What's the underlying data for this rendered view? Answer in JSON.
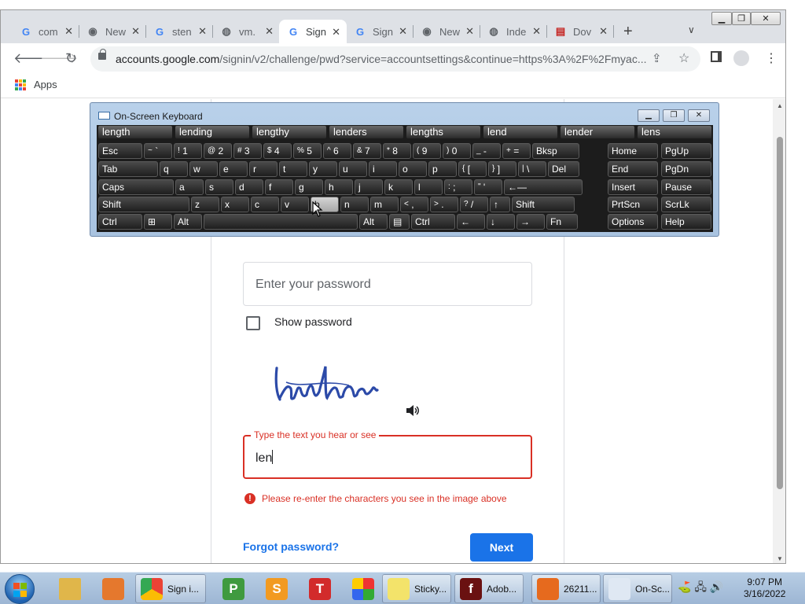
{
  "tabs": [
    {
      "title": "com",
      "favicon": "google-icon",
      "active": false
    },
    {
      "title": "New",
      "favicon": "chrome-icon",
      "active": false
    },
    {
      "title": "sten",
      "favicon": "google-icon",
      "active": false
    },
    {
      "title": "vm.",
      "favicon": "globe-icon",
      "active": false
    },
    {
      "title": "Sign",
      "favicon": "google-icon",
      "active": true
    },
    {
      "title": "Sign",
      "favicon": "google-icon",
      "active": false
    },
    {
      "title": "New",
      "favicon": "chrome-icon",
      "active": false
    },
    {
      "title": "Inde",
      "favicon": "globe-icon",
      "active": false
    },
    {
      "title": "Dov",
      "favicon": "doc-icon",
      "active": false
    }
  ],
  "omnibox": {
    "host": "accounts.google.com",
    "path": "/signin/v2/challenge/pwd?service=accountsettings&continue=https%3A%2F%2Fmyac..."
  },
  "bookmarks": {
    "apps_label": "Apps"
  },
  "signin": {
    "password_placeholder": "Enter your password",
    "show_password_label": "Show password",
    "captcha_label": "Type the text you hear or see",
    "captcha_value": "len",
    "error_text": "Please re-enter the characters you see in the image above",
    "forgot_label": "Forgot password?",
    "next_label": "Next"
  },
  "osk": {
    "title": "On-Screen Keyboard",
    "predictions": [
      "length",
      "lending",
      "lengthy",
      "lenders",
      "lengths",
      "lend",
      "lender",
      "lens"
    ],
    "row1": [
      {
        "t": "Esc",
        "w": 58
      },
      {
        "s": "~",
        "t": "`",
        "w": 38
      },
      {
        "s": "!",
        "t": "1",
        "w": 38
      },
      {
        "s": "@",
        "t": "2",
        "w": 38
      },
      {
        "s": "#",
        "t": "3",
        "w": 38
      },
      {
        "s": "$",
        "t": "4",
        "w": 38
      },
      {
        "s": "%",
        "t": "5",
        "w": 38
      },
      {
        "s": "^",
        "t": "6",
        "w": 38
      },
      {
        "s": "&",
        "t": "7",
        "w": 38
      },
      {
        "s": "*",
        "t": "8",
        "w": 38
      },
      {
        "s": "(",
        "t": "9",
        "w": 38
      },
      {
        "s": ")",
        "t": "0",
        "w": 38
      },
      {
        "s": "_",
        "t": "-",
        "w": 38
      },
      {
        "s": "+",
        "t": "=",
        "w": 38
      },
      {
        "t": "Bksp",
        "w": 62
      }
    ],
    "row2": [
      {
        "t": "Tab",
        "w": 78
      },
      {
        "t": "q",
        "w": 38
      },
      {
        "t": "w",
        "w": 38
      },
      {
        "t": "e",
        "w": 38
      },
      {
        "t": "r",
        "w": 38
      },
      {
        "t": "t",
        "w": 38
      },
      {
        "t": "y",
        "w": 38
      },
      {
        "t": "u",
        "w": 38
      },
      {
        "t": "i",
        "w": 38
      },
      {
        "t": "o",
        "w": 38
      },
      {
        "t": "p",
        "w": 38
      },
      {
        "s": "{",
        "t": "[",
        "w": 38
      },
      {
        "s": "}",
        "t": "]",
        "w": 38
      },
      {
        "s": "|",
        "t": "\\",
        "w": 38
      },
      {
        "t": "Del",
        "w": 42
      }
    ],
    "row3": [
      {
        "t": "Caps",
        "w": 98
      },
      {
        "t": "a",
        "w": 38
      },
      {
        "t": "s",
        "w": 38
      },
      {
        "t": "d",
        "w": 38
      },
      {
        "t": "f",
        "w": 38
      },
      {
        "t": "g",
        "w": 38
      },
      {
        "t": "h",
        "w": 38
      },
      {
        "t": "j",
        "w": 38
      },
      {
        "t": "k",
        "w": 38
      },
      {
        "t": "l",
        "w": 38
      },
      {
        "s": ":",
        "t": ";",
        "w": 38
      },
      {
        "s": "\"",
        "t": "'",
        "w": 38
      },
      {
        "t": "←—",
        "w": 102
      }
    ],
    "row4": [
      {
        "t": "Shift",
        "w": 118
      },
      {
        "t": "z",
        "w": 38
      },
      {
        "t": "x",
        "w": 38
      },
      {
        "t": "c",
        "w": 38
      },
      {
        "t": "v",
        "w": 38
      },
      {
        "t": "b",
        "w": 38,
        "hl": true
      },
      {
        "t": "n",
        "w": 38
      },
      {
        "t": "m",
        "w": 38
      },
      {
        "s": "<",
        "t": ",",
        "w": 38
      },
      {
        "s": ">",
        "t": ".",
        "w": 38
      },
      {
        "s": "?",
        "t": "/",
        "w": 38
      },
      {
        "t": "↑",
        "w": 28
      },
      {
        "t": "Shift",
        "w": 82
      }
    ],
    "row5": [
      {
        "t": "Ctrl",
        "w": 58
      },
      {
        "t": "⊞",
        "w": 38
      },
      {
        "t": "Alt",
        "w": 38
      },
      {
        "t": "",
        "w": 198
      },
      {
        "t": "Alt",
        "w": 38
      },
      {
        "t": "▤",
        "w": 28
      },
      {
        "t": "Ctrl",
        "w": 58
      },
      {
        "t": "←",
        "w": 38
      },
      {
        "t": "↓",
        "w": 38
      },
      {
        "t": "→",
        "w": 38
      },
      {
        "t": "Fn",
        "w": 42
      }
    ],
    "nav": [
      [
        "Home",
        "PgUp"
      ],
      [
        "End",
        "PgDn"
      ],
      [
        "Insert",
        "Pause"
      ],
      [
        "PrtScn",
        "ScrLk"
      ],
      [
        "Options",
        "Help"
      ]
    ]
  },
  "taskbar": {
    "items": [
      {
        "name": "explorer-icon",
        "label": "",
        "color": "#e0b64a"
      },
      {
        "name": "media-player-icon",
        "label": "",
        "color": "#e5782d"
      },
      {
        "name": "chrome-icon",
        "label": "Sign i...",
        "color": "#ffffff",
        "win": true
      },
      {
        "name": "publisher-icon",
        "label": "",
        "color": "#3f9a3f",
        "glyph": "P"
      },
      {
        "name": "sheets-icon",
        "label": "",
        "color": "#f29a21",
        "glyph": "S"
      },
      {
        "name": "text-icon",
        "label": "",
        "color": "#d22b2b",
        "glyph": "T"
      },
      {
        "name": "paint-icon",
        "label": "",
        "color": "#ffffff"
      },
      {
        "name": "sticky-notes-icon",
        "label": "Sticky...",
        "color": "#f3e36a",
        "win": true
      },
      {
        "name": "flash-icon",
        "label": "Adob...",
        "color": "#6a1111",
        "win": true,
        "glyph": "f"
      },
      {
        "name": "firefox-icon",
        "label": "26211...",
        "color": "#e66a1e",
        "win": true
      },
      {
        "name": "osk-icon",
        "label": "On-Sc...",
        "color": "#dfe8f3",
        "win": true
      }
    ],
    "time": "9:07 PM",
    "date": "3/16/2022"
  }
}
